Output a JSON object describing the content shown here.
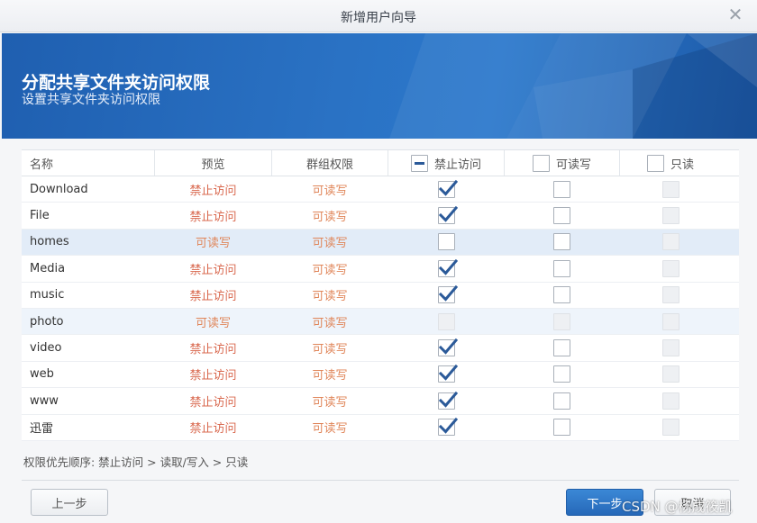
{
  "window": {
    "title": "新增用户向导",
    "close_glyph": "✕"
  },
  "banner": {
    "title": "分配共享文件夹访问权限",
    "subtitle": "设置共享文件夹访问权限"
  },
  "table": {
    "headers": {
      "name": "名称",
      "preview": "预览",
      "group": "群组权限",
      "deny": "禁止访问",
      "rw": "可读写",
      "ro": "只读"
    },
    "rows": [
      {
        "name": "Download",
        "preview": "禁止访问",
        "group": "可读写",
        "deny": true,
        "rw": false,
        "ro_disabled": true,
        "rw_disabled": false,
        "deny_disabled": false
      },
      {
        "name": "File",
        "preview": "禁止访问",
        "group": "可读写",
        "deny": true,
        "rw": false,
        "ro_disabled": true,
        "rw_disabled": false,
        "deny_disabled": false
      },
      {
        "name": "homes",
        "preview": "可读写",
        "group": "可读写",
        "deny": false,
        "rw": false,
        "ro_disabled": true,
        "rw_disabled": false,
        "deny_disabled": false
      },
      {
        "name": "Media",
        "preview": "禁止访问",
        "group": "可读写",
        "deny": true,
        "rw": false,
        "ro_disabled": true,
        "rw_disabled": false,
        "deny_disabled": false
      },
      {
        "name": "music",
        "preview": "禁止访问",
        "group": "可读写",
        "deny": true,
        "rw": false,
        "ro_disabled": true,
        "rw_disabled": false,
        "deny_disabled": false
      },
      {
        "name": "photo",
        "preview": "可读写",
        "group": "可读写",
        "deny": false,
        "rw": false,
        "ro_disabled": true,
        "rw_disabled": true,
        "deny_disabled": true
      },
      {
        "name": "video",
        "preview": "禁止访问",
        "group": "可读写",
        "deny": true,
        "rw": false,
        "ro_disabled": true,
        "rw_disabled": false,
        "deny_disabled": false
      },
      {
        "name": "web",
        "preview": "禁止访问",
        "group": "可读写",
        "deny": true,
        "rw": false,
        "ro_disabled": true,
        "rw_disabled": false,
        "deny_disabled": false
      },
      {
        "name": "www",
        "preview": "禁止访问",
        "group": "可读写",
        "deny": true,
        "rw": false,
        "ro_disabled": true,
        "rw_disabled": false,
        "deny_disabled": false
      },
      {
        "name": "迅雷",
        "preview": "禁止访问",
        "group": "可读写",
        "deny": true,
        "rw": false,
        "ro_disabled": true,
        "rw_disabled": false,
        "deny_disabled": false
      }
    ]
  },
  "footnote": "权限优先顺序:  禁止访问 > 读取/写入 > 只读",
  "buttons": {
    "prev": "上一步",
    "next": "下一步",
    "cancel": "取消"
  },
  "watermark": "CSDN @杨成筱凯",
  "colors": {
    "banner_blue": "#2a72c4",
    "deny_text": "#d9684e",
    "rw_text": "#e0865a",
    "check": "#2b5a99"
  }
}
